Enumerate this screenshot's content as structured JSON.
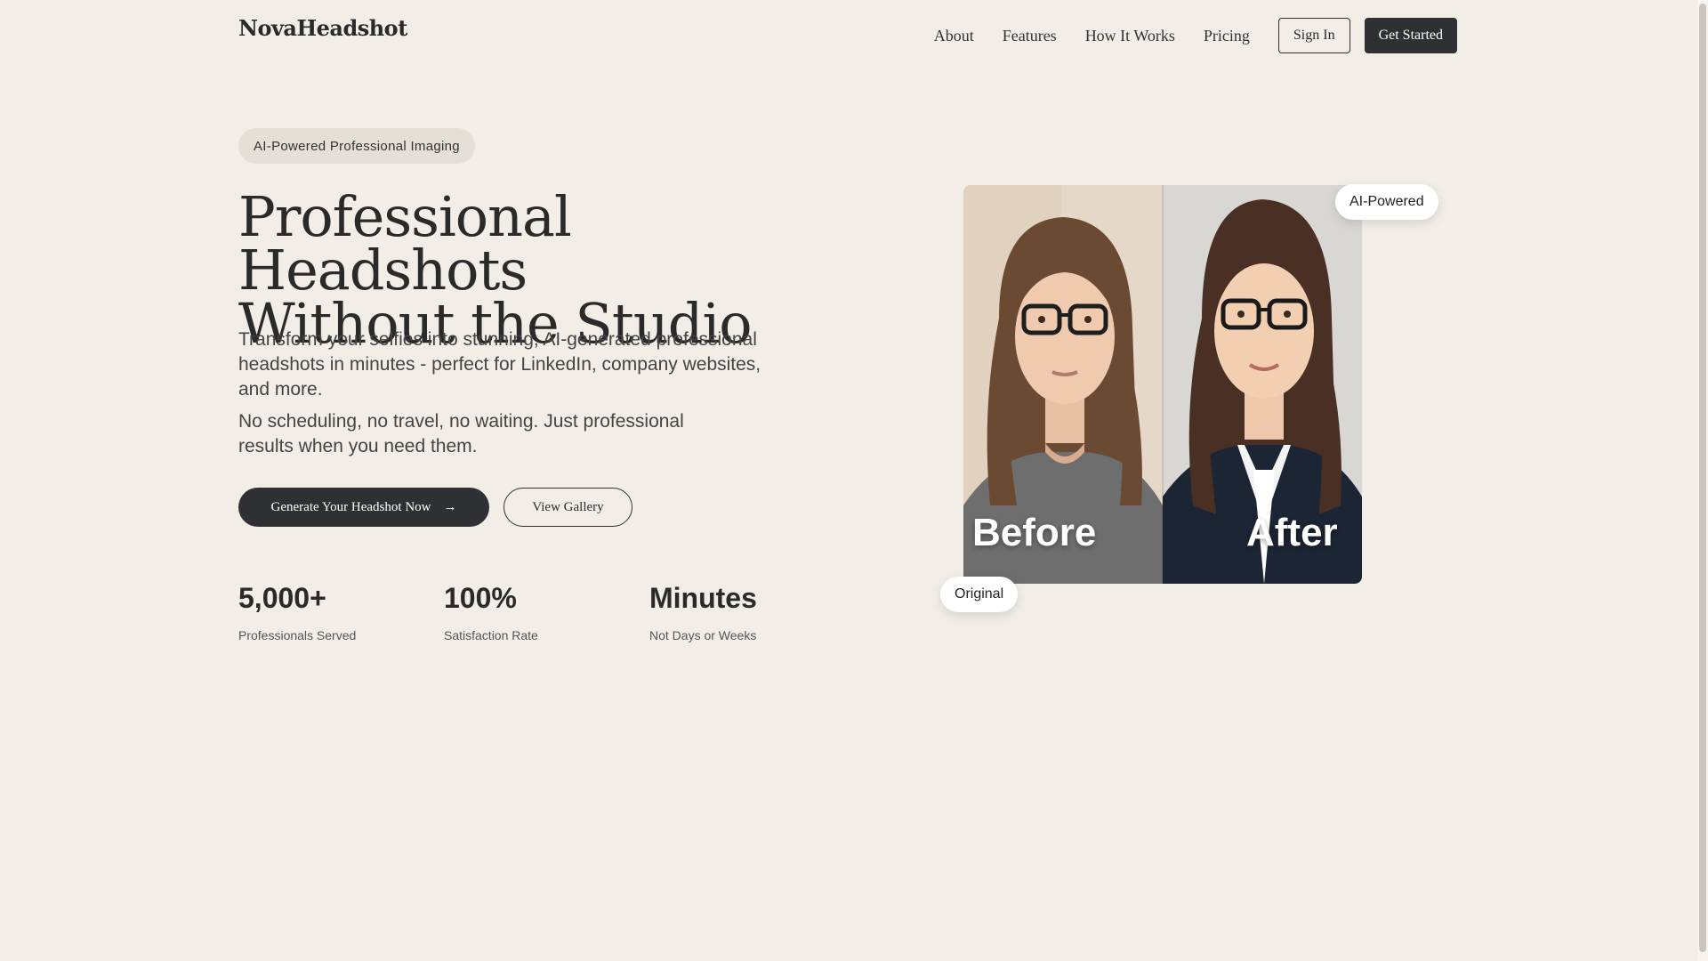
{
  "header": {
    "logo": "NovaHeadshot",
    "nav": [
      "About",
      "Features",
      "How It Works",
      "Pricing"
    ],
    "sign_in": "Sign In",
    "get_started": "Get Started"
  },
  "hero": {
    "pill": "AI-Powered Professional Imaging",
    "title_line1": "Professional Headshots",
    "title_line2": "Without the Studio",
    "sub1": "Transform your selfies into stunning, AI-generated professional headshots in minutes - perfect for LinkedIn, company websites, and more.",
    "sub2": "No scheduling, no travel, no waiting. Just professional results when you need them.",
    "cta_primary": "Generate Your Headshot Now",
    "cta_arrow": "→",
    "cta_secondary": "View Gallery"
  },
  "stats": [
    {
      "value": "5,000+",
      "label": "Professionals Served"
    },
    {
      "value": "100%",
      "label": "Satisfaction Rate"
    },
    {
      "value": "Minutes",
      "label": "Not Days or Weeks"
    }
  ],
  "showcase": {
    "before_label": "Before",
    "after_label": "After",
    "badge_top": "AI-Powered",
    "badge_bottom": "Original"
  },
  "colors": {
    "background": "#f2eee7",
    "primary_button": "#2f3033",
    "pill_background": "#e4dfd7"
  }
}
